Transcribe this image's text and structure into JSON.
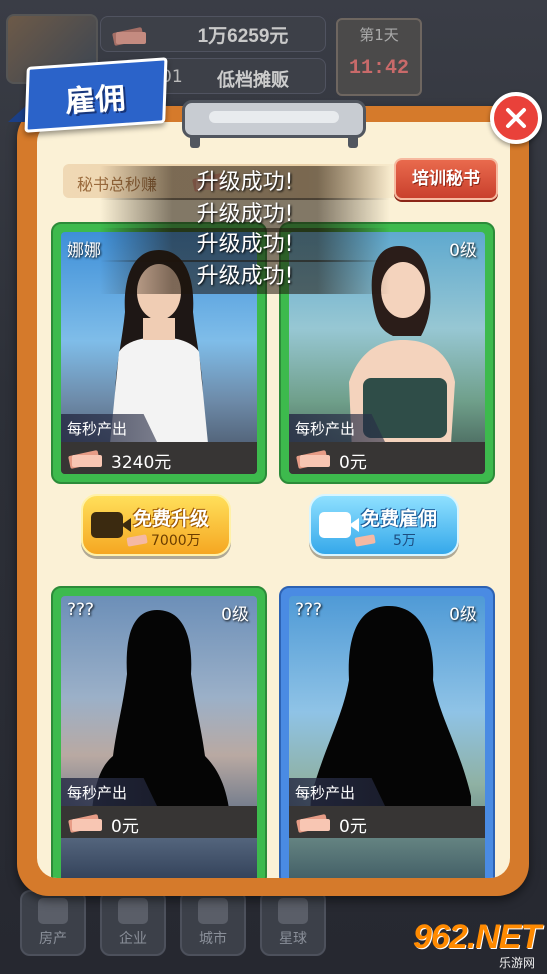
{
  "hud": {
    "money": "1万6259元",
    "rank_prefix": "01",
    "stage": "低档摊贩",
    "day": "第1天",
    "time": "11:42"
  },
  "modal": {
    "title": "雇佣",
    "earn_label": "秘书总秒赚",
    "train_button": "培训秘书"
  },
  "toasts": [
    "升级成功!",
    "升级成功!",
    "升级成功!",
    "升级成功!"
  ],
  "cards": [
    {
      "name": "娜娜",
      "level": "",
      "output_label": "每秒产出",
      "output_value": "3240元",
      "frame": "green",
      "locked": false
    },
    {
      "name": "",
      "level": "0级",
      "output_label": "每秒产出",
      "output_value": "0元",
      "frame": "green",
      "locked": false
    },
    {
      "name": "???",
      "level": "0级",
      "output_label": "每秒产出",
      "output_value": "0元",
      "frame": "green",
      "locked": true
    },
    {
      "name": "???",
      "level": "0级",
      "output_label": "每秒产出",
      "output_value": "0元",
      "frame": "blue",
      "locked": true
    }
  ],
  "actions": {
    "upgrade": {
      "label": "免费升级",
      "cost": "7000万"
    },
    "hire": {
      "label": "免费雇佣",
      "cost": "5万"
    }
  },
  "nav": [
    "房产",
    "企业",
    "城市",
    "星球"
  ],
  "watermark": {
    "logo": "962.NET",
    "sub": "乐游网"
  },
  "colors": {
    "modal_frame": "#d57a2b",
    "card_green": "#3dba4d",
    "card_blue": "#4a8be3",
    "close": "#e9413a"
  }
}
